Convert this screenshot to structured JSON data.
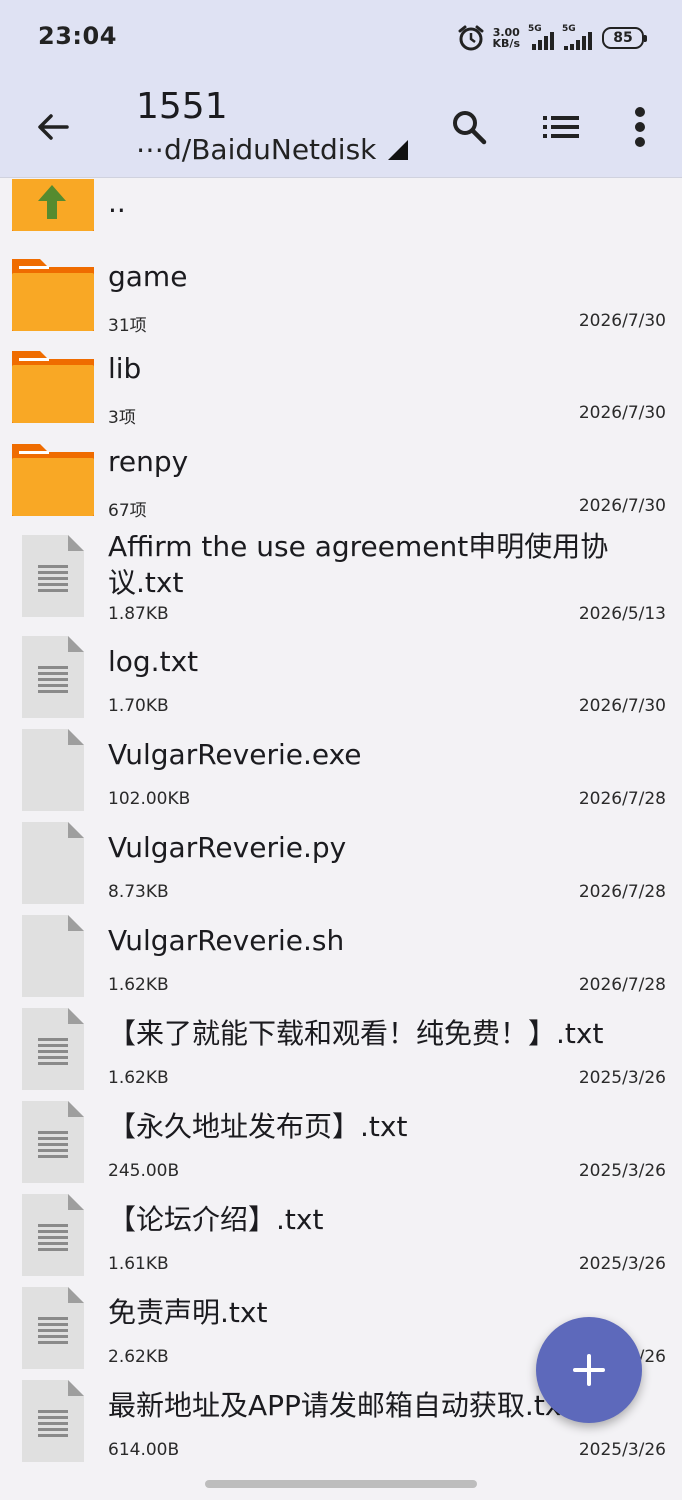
{
  "status": {
    "time": "23:04",
    "speed_value": "3.00",
    "speed_unit": "KB/s",
    "sim1": "5G",
    "sim2": "5G",
    "battery": "85"
  },
  "header": {
    "title": "1551",
    "path": "⋯d/BaiduNetdisk"
  },
  "parent_item": {
    "name": ".."
  },
  "files": [
    {
      "name": "game",
      "meta": "31项",
      "date": "2026/7/30",
      "type": "folder"
    },
    {
      "name": "lib",
      "meta": "3项",
      "date": "2026/7/30",
      "type": "folder"
    },
    {
      "name": "renpy",
      "meta": "67项",
      "date": "2026/7/30",
      "type": "folder"
    },
    {
      "name": "Affirm the use agreement申明使用协议.txt",
      "meta": "1.87KB",
      "date": "2026/5/13",
      "type": "text"
    },
    {
      "name": "log.txt",
      "meta": "1.70KB",
      "date": "2026/7/30",
      "type": "text"
    },
    {
      "name": "VulgarReverie.exe",
      "meta": "102.00KB",
      "date": "2026/7/28",
      "type": "blank"
    },
    {
      "name": "VulgarReverie.py",
      "meta": "8.73KB",
      "date": "2026/7/28",
      "type": "blank"
    },
    {
      "name": "VulgarReverie.sh",
      "meta": "1.62KB",
      "date": "2026/7/28",
      "type": "blank"
    },
    {
      "name": "【来了就能下载和观看！纯免费！】.txt",
      "meta": "1.62KB",
      "date": "2025/3/26",
      "type": "text"
    },
    {
      "name": "【永久地址发布页】.txt",
      "meta": "245.00B",
      "date": "2025/3/26",
      "type": "text"
    },
    {
      "name": "【论坛介绍】.txt",
      "meta": "1.61KB",
      "date": "2025/3/26",
      "type": "text"
    },
    {
      "name": "免责声明.txt",
      "meta": "2.62KB",
      "date": "2025/3/26",
      "type": "text"
    },
    {
      "name": "最新地址及APP请发邮箱自动获取.txt",
      "meta": "614.00B",
      "date": "2025/3/26",
      "type": "text"
    }
  ],
  "colors": {
    "appbar": "#dfe2f3",
    "folder": "#f9a825",
    "folder_tab": "#ef6c00",
    "up_arrow": "#558b2f",
    "fab": "#5d69bb"
  }
}
